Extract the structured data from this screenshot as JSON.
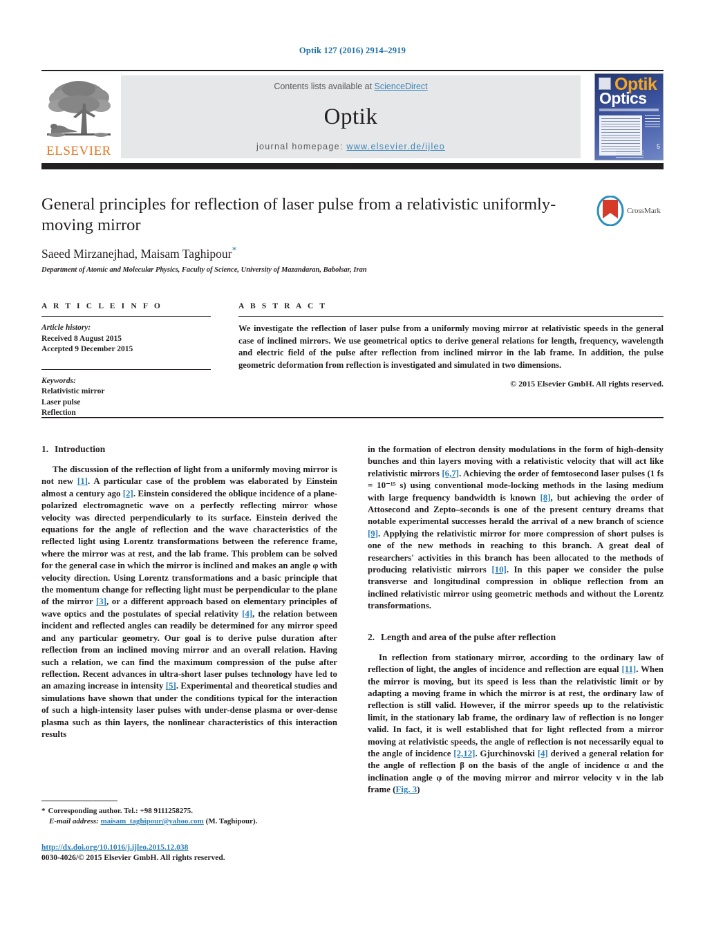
{
  "running_head": "Optik 127 (2016) 2914–2919",
  "masthead": {
    "contents_prefix": "Contents lists available at ",
    "sciencedirect": "ScienceDirect",
    "journal_name": "Optik",
    "homepage_prefix": "journal homepage: ",
    "homepage_url": "www.elsevier.de/ijleo",
    "publisher": "ELSEVIER",
    "cover": {
      "title_top": "Optik",
      "title_bottom": "Optics",
      "page_num": "5"
    },
    "link_color": "#3a85b8",
    "publisher_color": "#e87722"
  },
  "article": {
    "title": "General principles for reflection of laser pulse from a relativistic uniformly-moving mirror",
    "authors": "Saeed Mirzanejhad, Maisam Taghipour",
    "corresponding_marker": "*",
    "affiliation": "Department of Atomic and Molecular Physics, Faculty of Science, University of Mazandaran, Babolsar, Iran",
    "crossmark_label": "CrossMark"
  },
  "info": {
    "heading": "A R T I C L E   I N F O",
    "history_label": "Article history:",
    "received": "Received 8 August 2015",
    "accepted": "Accepted 9 December 2015",
    "keywords_label": "Keywords:",
    "keywords": [
      "Relativistic mirror",
      "Laser pulse",
      "Reflection"
    ]
  },
  "abstract": {
    "heading": "A B S T R A C T",
    "text": "We investigate the reflection of laser pulse from a uniformly moving mirror at relativistic speeds in the general case of inclined mirrors. We use geometrical optics to derive general relations for length, frequency, wavelength and electric field of the pulse after reflection from inclined mirror in the lab frame. In addition, the pulse geometric deformation from reflection is investigated and simulated in two dimensions.",
    "copyright": "© 2015 Elsevier GmbH. All rights reserved."
  },
  "body": {
    "section1": {
      "number": "1.",
      "title": "Introduction",
      "paragraph_parts": [
        "The discussion of the reflection of light from a uniformly moving mirror is not new ",
        "[1]",
        ". A particular case of the problem was elaborated by Einstein almost a century ago ",
        "[2]",
        ". Einstein considered the oblique incidence of a plane-polarized electromagnetic wave on a perfectly reflecting mirror whose velocity was directed perpendicularly to its surface. Einstein derived the equations for the angle of reflection and the wave characteristics of the reflected light using Lorentz transformations between the reference frame, where the mirror was at rest, and the lab frame. This problem can be solved for the general case in which the mirror is inclined and makes an angle φ with velocity direction. Using Lorentz transformations and a basic principle that the momentum change for reflecting light must be perpendicular to the plane of the mirror ",
        "[3]",
        ", or a different approach based on elementary principles of wave optics and the postulates of special relativity ",
        "[4]",
        ", the relation between incident and reflected angles can readily be determined for any mirror speed and any particular geometry. Our goal is to derive pulse duration after reflection from an inclined moving mirror and an overall relation. Having such a relation, we can find the maximum compression of the pulse after reflection. Recent advances in ultra-short laser pulses technology have led to an amazing increase in intensity ",
        "[5]",
        ". Experimental and theoretical studies and simulations have shown that under the conditions typical for the interaction of such a high-intensity laser pulses with under-dense plasma or over-dense plasma such as thin layers, the nonlinear characteristics of this interaction results"
      ],
      "continuation_parts": [
        "in the formation of electron density modulations in the form of high-density bunches and thin layers moving with a relativistic velocity that will act like relativistic mirrors ",
        "[6,7]",
        ". Achieving the order of femtosecond laser pulses (1 fs = 10⁻¹⁵ s) using conventional mode-locking methods in the lasing medium with large frequency bandwidth is known ",
        "[8]",
        ", but achieving the order of Attosecond and Zepto–seconds is one of the present century dreams that notable experimental successes herald the arrival of a new branch of science ",
        "[9]",
        ". Applying the relativistic mirror for more compression of short pulses is one of the new methods in reaching to this branch. A great deal of researchers' activities in this branch has been allocated to the methods of producing relativistic mirrors ",
        "[10]",
        ". In this paper we consider the pulse transverse and longitudinal compression in oblique reflection from an inclined relativistic mirror using geometric methods and without the Lorentz transformations."
      ]
    },
    "section2": {
      "number": "2.",
      "title": "Length and area of the pulse after reflection",
      "paragraph_parts": [
        "In reflection from stationary mirror, according to the ordinary law of reflection of light, the angles of incidence and reflection are equal ",
        "[11]",
        ". When the mirror is moving, but its speed is less than the relativistic limit or by adapting a moving frame in which the mirror is at rest, the ordinary law of reflection is still valid. However, if the mirror speeds up to the relativistic limit, in the stationary lab frame, the ordinary law of reflection is no longer valid. In fact, it is well established that for light reflected from a mirror moving at relativistic speeds, the angle of reflection is not necessarily equal to the angle of incidence ",
        "[2,12]",
        ". Gjurchinovski ",
        "[4]",
        " derived a general relation for the angle of reflection β on the basis of the angle of incidence α and the inclination angle φ of the moving mirror and mirror velocity v in the lab frame (",
        "Fig. 3",
        ")"
      ]
    }
  },
  "footnote": {
    "star": "*",
    "corresponding": "Corresponding author. Tel.: +98 9111258275.",
    "email_label": "E-mail address:",
    "email": "maisam_taghipour@yahoo.com",
    "email_suffix": "(M. Taghipour).",
    "doi": "http://dx.doi.org/10.1016/j.ijleo.2015.12.038",
    "issn": "0030-4026/© 2015 Elsevier GmbH. All rights reserved."
  },
  "colors": {
    "link": "#2c7fb8",
    "rule": "#231f20",
    "masthead_bg": "#e6e7e8"
  }
}
